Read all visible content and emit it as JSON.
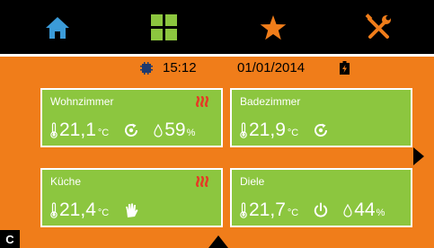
{
  "nav": {
    "items": [
      {
        "icon": "home-icon",
        "color": "#3b9bd8"
      },
      {
        "icon": "grid-icon",
        "color": "#8cc63f"
      },
      {
        "icon": "star-icon",
        "color": "#f07d1a"
      },
      {
        "icon": "tools-icon",
        "color": "#f07d1a"
      }
    ]
  },
  "status": {
    "time": "15:12",
    "date": "01/01/2014"
  },
  "rooms": [
    {
      "name": "Wohnzimmer",
      "heating": true,
      "temp": "21,1",
      "unit": "°C",
      "mode": "auto",
      "humidity": "59",
      "hum_unit": "%"
    },
    {
      "name": "Badezimmer",
      "heating": false,
      "temp": "21,9",
      "unit": "°C",
      "mode": "auto"
    },
    {
      "name": "Küche",
      "heating": true,
      "temp": "21,4",
      "unit": "°C",
      "mode": "manual"
    },
    {
      "name": "Diele",
      "heating": false,
      "temp": "21,7",
      "unit": "°C",
      "mode": "off",
      "humidity": "44",
      "hum_unit": "%"
    }
  ],
  "corner_label": "C",
  "colors": {
    "background": "#f07d1a",
    "tile": "#8cc63f",
    "heat": "#e53a25",
    "navbar": "#000000"
  }
}
